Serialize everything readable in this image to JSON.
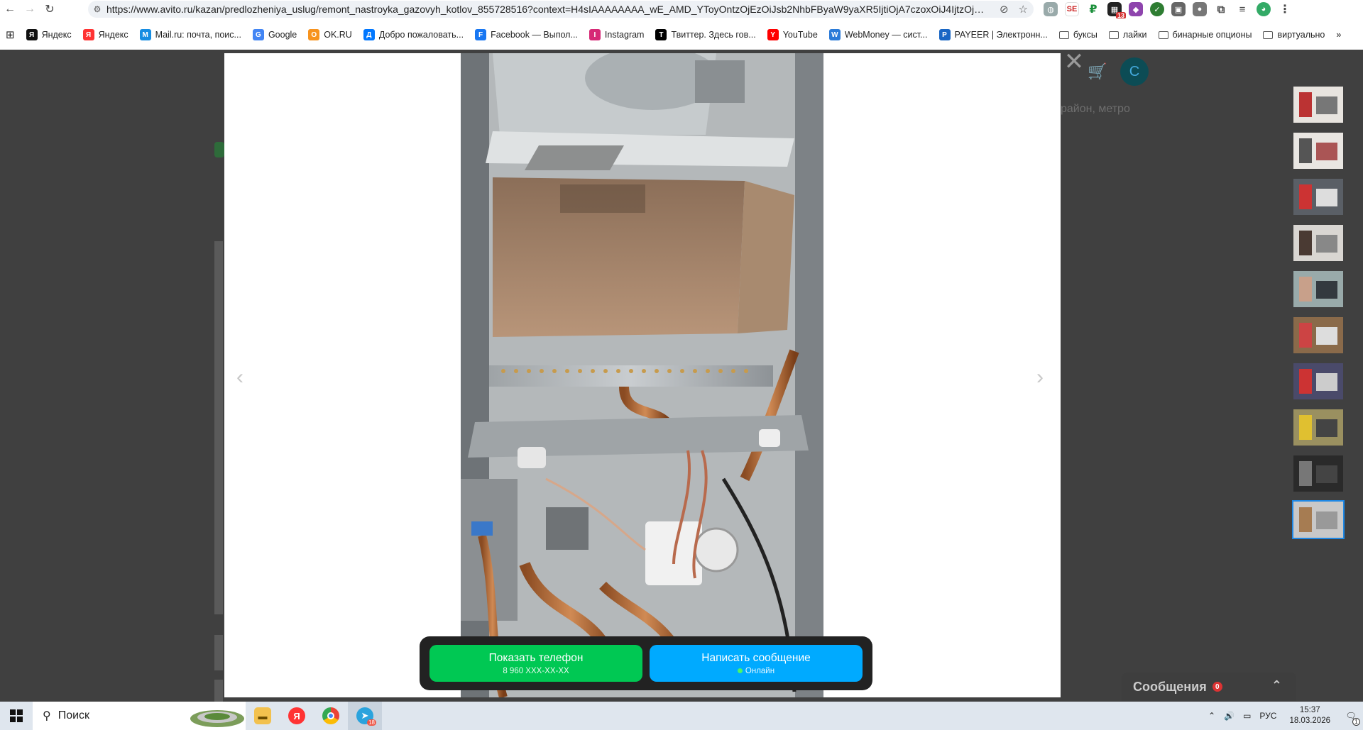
{
  "browser": {
    "url": "https://www.avito.ru/kazan/predlozheniya_uslug/remont_nastroyka_gazovyh_kotlov_855728516?context=H4sIAAAAAAAA_wE_AMD_YToyOntzOjEzOiJsb2NhbFByaW9yaXR5IjtiOjA7czoxOiJ4IjtzOjE2O...",
    "bookmarks": [
      {
        "label": "Яндекс",
        "icon": "yandex-plus-icon",
        "color": "#111"
      },
      {
        "label": "Яндекс",
        "icon": "yandex-icon",
        "color": "#f33"
      },
      {
        "label": "Mail.ru: почта, поис...",
        "icon": "mailru-icon",
        "color": "#168de2"
      },
      {
        "label": "Google",
        "icon": "google-icon",
        "color": "#4285f4"
      },
      {
        "label": "OK.RU",
        "icon": "ok-icon",
        "color": "#f7931e"
      },
      {
        "label": "Добро пожаловать...",
        "icon": "vk-icon",
        "color": "#0077ff"
      },
      {
        "label": "Facebook — Выпол...",
        "icon": "facebook-icon",
        "color": "#1877f2"
      },
      {
        "label": "Instagram",
        "icon": "instagram-icon",
        "color": "#d62976"
      },
      {
        "label": "Твиттер. Здесь гов...",
        "icon": "x-icon",
        "color": "#000"
      },
      {
        "label": "YouTube",
        "icon": "youtube-icon",
        "color": "#f00"
      },
      {
        "label": "WebMoney — сист...",
        "icon": "webmoney-icon",
        "color": "#2b7bd8"
      },
      {
        "label": "PAYEER | Электронн...",
        "icon": "payeer-icon",
        "color": "#1966c4"
      }
    ],
    "folders": [
      "буксы",
      "лайки",
      "бинарные опционы",
      "виртуально"
    ]
  },
  "page_behind": {
    "location_hint": "район, метро",
    "avatar_letter": "С"
  },
  "gallery": {
    "close_symbol": "✕",
    "prev_symbol": "‹",
    "next_symbol": "›",
    "thumbnail_count": 10,
    "active_thumbnail": 10
  },
  "cta": {
    "phone_label": "Показать телефон",
    "phone_masked": "8 960 XXX-XX-XX",
    "message_label": "Написать сообщение",
    "online_status": "Онлайн"
  },
  "messages_widget": {
    "label": "Сообщения",
    "count": "0"
  },
  "taskbar": {
    "search_label": "Поиск",
    "telegram_badge": "18",
    "language": "РУС",
    "time": "15:37",
    "date": "18.03.2026",
    "notifications": "1"
  },
  "colors": {
    "phone_button": "#00c853",
    "message_button": "#00aaff",
    "active_thumb_border": "#1e88e5"
  }
}
